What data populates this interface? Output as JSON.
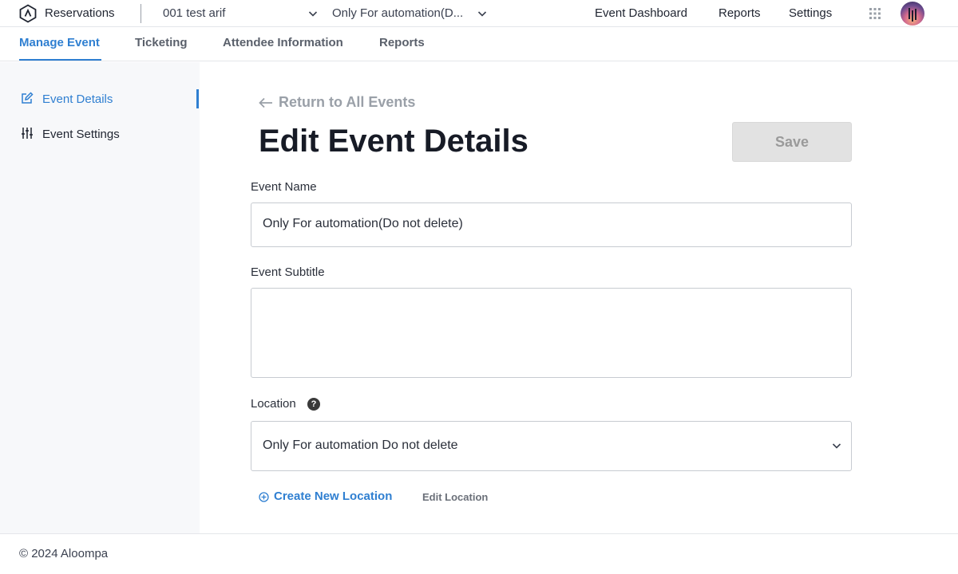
{
  "header": {
    "app_name": "Reservations",
    "account": "001 test arif",
    "event": "Only For automation(D...",
    "nav": [
      "Event Dashboard",
      "Reports",
      "Settings"
    ],
    "icons": {
      "logo": "triangle-logo-icon",
      "apps": "grid-icon",
      "avatar": "user-avatar"
    }
  },
  "tabs": [
    {
      "label": "Manage Event",
      "active": true
    },
    {
      "label": "Ticketing",
      "active": false
    },
    {
      "label": "Attendee Information",
      "active": false
    },
    {
      "label": "Reports",
      "active": false
    }
  ],
  "sidebar": {
    "items": [
      {
        "label": "Event Details",
        "icon": "edit-icon",
        "active": true
      },
      {
        "label": "Event Settings",
        "icon": "sliders-icon",
        "active": false
      }
    ]
  },
  "main": {
    "return_label": "Return to All Events",
    "title": "Edit Event Details",
    "save_label": "Save",
    "fields": {
      "event_name": {
        "label": "Event Name",
        "value": "Only For automation(Do not delete)"
      },
      "event_subtitle": {
        "label": "Event Subtitle",
        "value": ""
      },
      "location": {
        "label": "Location",
        "help": "?",
        "value": "Only For automation Do not delete"
      }
    },
    "create_location": "Create New Location",
    "edit_location": "Edit Location"
  },
  "footer": {
    "copyright": "© 2024 Aloompa"
  },
  "colors": {
    "accent": "#2f7fd1",
    "save_disabled_bg": "#e2e2e2",
    "sidebar_bg": "#f7f8fa"
  }
}
